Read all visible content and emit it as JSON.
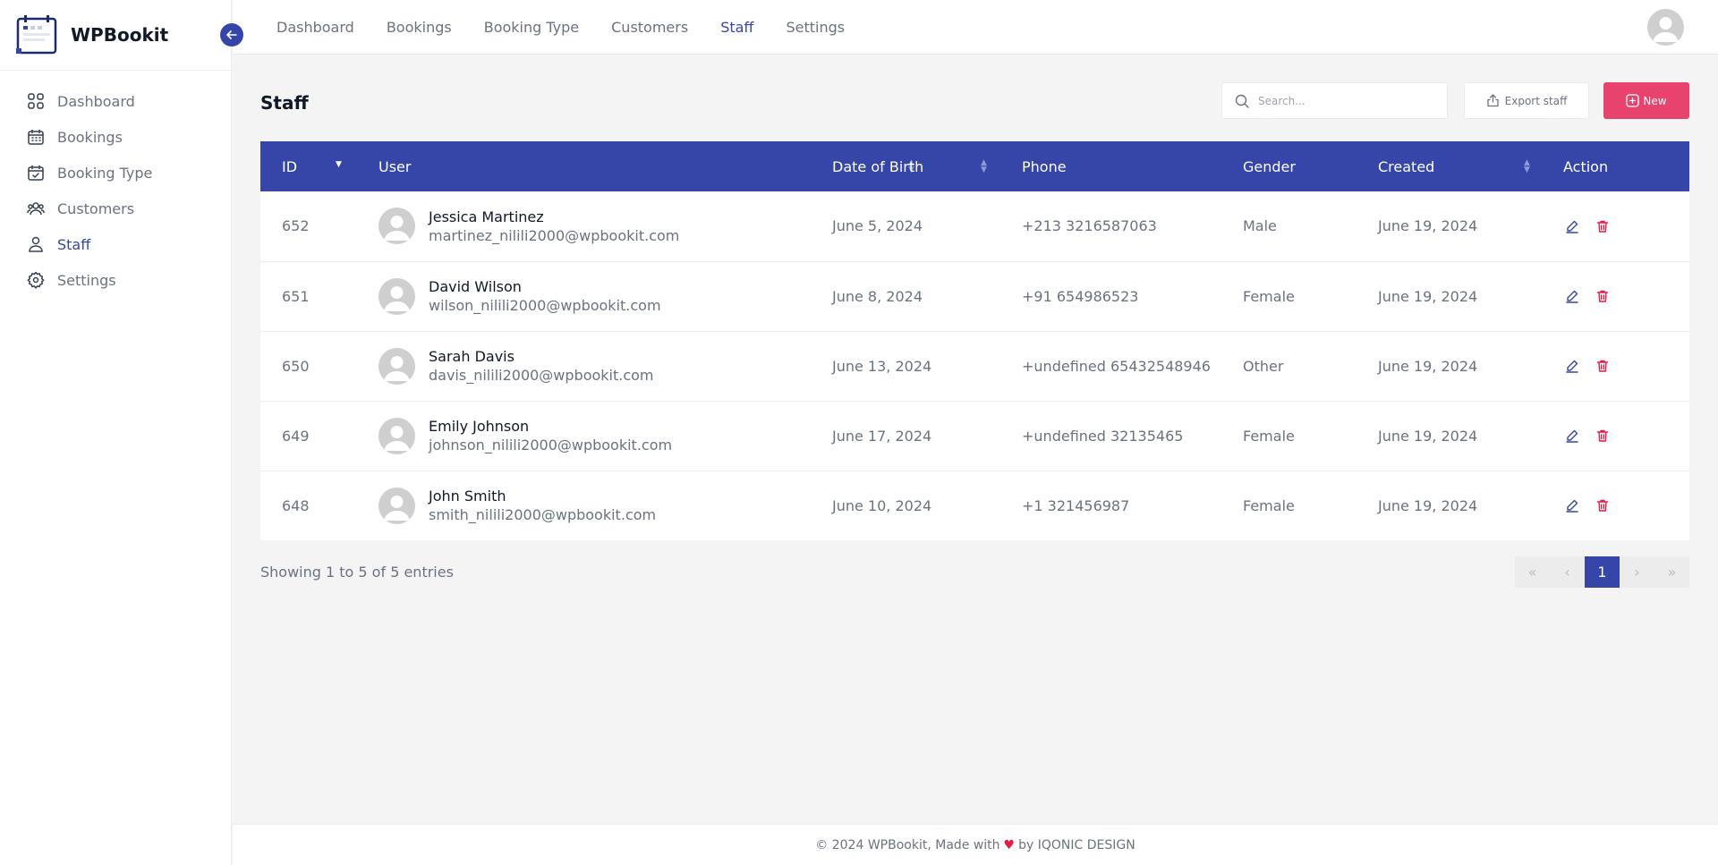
{
  "brand": {
    "name": "WPBookit"
  },
  "sidebar": {
    "items": [
      {
        "label": "Dashboard",
        "icon": "grid-icon"
      },
      {
        "label": "Bookings",
        "icon": "calendar-icon"
      },
      {
        "label": "Booking Type",
        "icon": "calendar-check-icon"
      },
      {
        "label": "Customers",
        "icon": "users-icon"
      },
      {
        "label": "Staff",
        "icon": "user-icon",
        "active": true
      },
      {
        "label": "Settings",
        "icon": "gear-icon"
      }
    ]
  },
  "topnav": {
    "items": [
      "Dashboard",
      "Bookings",
      "Booking Type",
      "Customers",
      "Staff",
      "Settings"
    ],
    "active": "Staff"
  },
  "page": {
    "title": "Staff"
  },
  "toolbar": {
    "search_placeholder": "Search...",
    "export_label": "Export staff",
    "new_label": "New"
  },
  "table": {
    "headers": {
      "id": "ID",
      "user": "User",
      "dob": "Date of Birth",
      "phone": "Phone",
      "gender": "Gender",
      "created": "Created",
      "action": "Action"
    },
    "rows": [
      {
        "id": "652",
        "name": "Jessica Martinez",
        "email": "martinez_nilili2000@wpbookit.com",
        "dob": "June 5, 2024",
        "phone": "+213 3216587063",
        "gender": "Male",
        "created": "June 19, 2024"
      },
      {
        "id": "651",
        "name": "David Wilson",
        "email": "wilson_nilili2000@wpbookit.com",
        "dob": "June 8, 2024",
        "phone": "+91 654986523",
        "gender": "Female",
        "created": "June 19, 2024"
      },
      {
        "id": "650",
        "name": "Sarah Davis",
        "email": "davis_nilili2000@wpbookit.com",
        "dob": "June 13, 2024",
        "phone": "+undefined 65432548946",
        "gender": "Other",
        "created": "June 19, 2024"
      },
      {
        "id": "649",
        "name": "Emily Johnson",
        "email": "johnson_nilili2000@wpbookit.com",
        "dob": "June 17, 2024",
        "phone": "+undefined 32135465",
        "gender": "Female",
        "created": "June 19, 2024"
      },
      {
        "id": "648",
        "name": "John Smith",
        "email": "smith_nilili2000@wpbookit.com",
        "dob": "June 10, 2024",
        "phone": "+1 321456987",
        "gender": "Female",
        "created": "June 19, 2024"
      }
    ]
  },
  "pagination": {
    "showing": "Showing 1 to 5 of 5 entries",
    "first": "«",
    "prev": "‹",
    "current": "1",
    "next": "›",
    "last": "»"
  },
  "footer": {
    "prefix": "© 2024 WPBookit, Made with",
    "suffix": "by IQONIC DESIGN"
  },
  "colors": {
    "primary": "#3645a8",
    "accent": "#e8436f",
    "background": "#f4f4f5"
  }
}
